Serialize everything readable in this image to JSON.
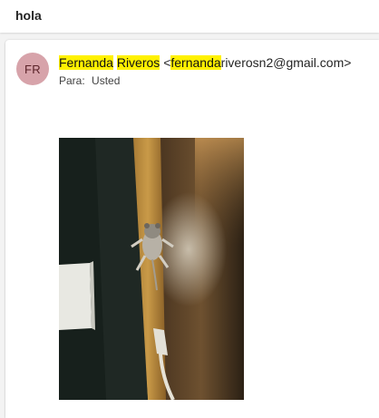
{
  "subject": "hola",
  "sender": {
    "initials": "FR",
    "first_name": "Fernanda",
    "last_name": "Riveros",
    "email_prefix": "<",
    "email_highlight": "fernanda",
    "email_rest": "riverosn2@gmail.com",
    "email_suffix": ">"
  },
  "recipient": {
    "label": "Para:",
    "value": "Usted"
  },
  "colors": {
    "highlight": "#fff100",
    "avatar_bg": "#d7a3aa",
    "avatar_text": "#5b2329"
  }
}
